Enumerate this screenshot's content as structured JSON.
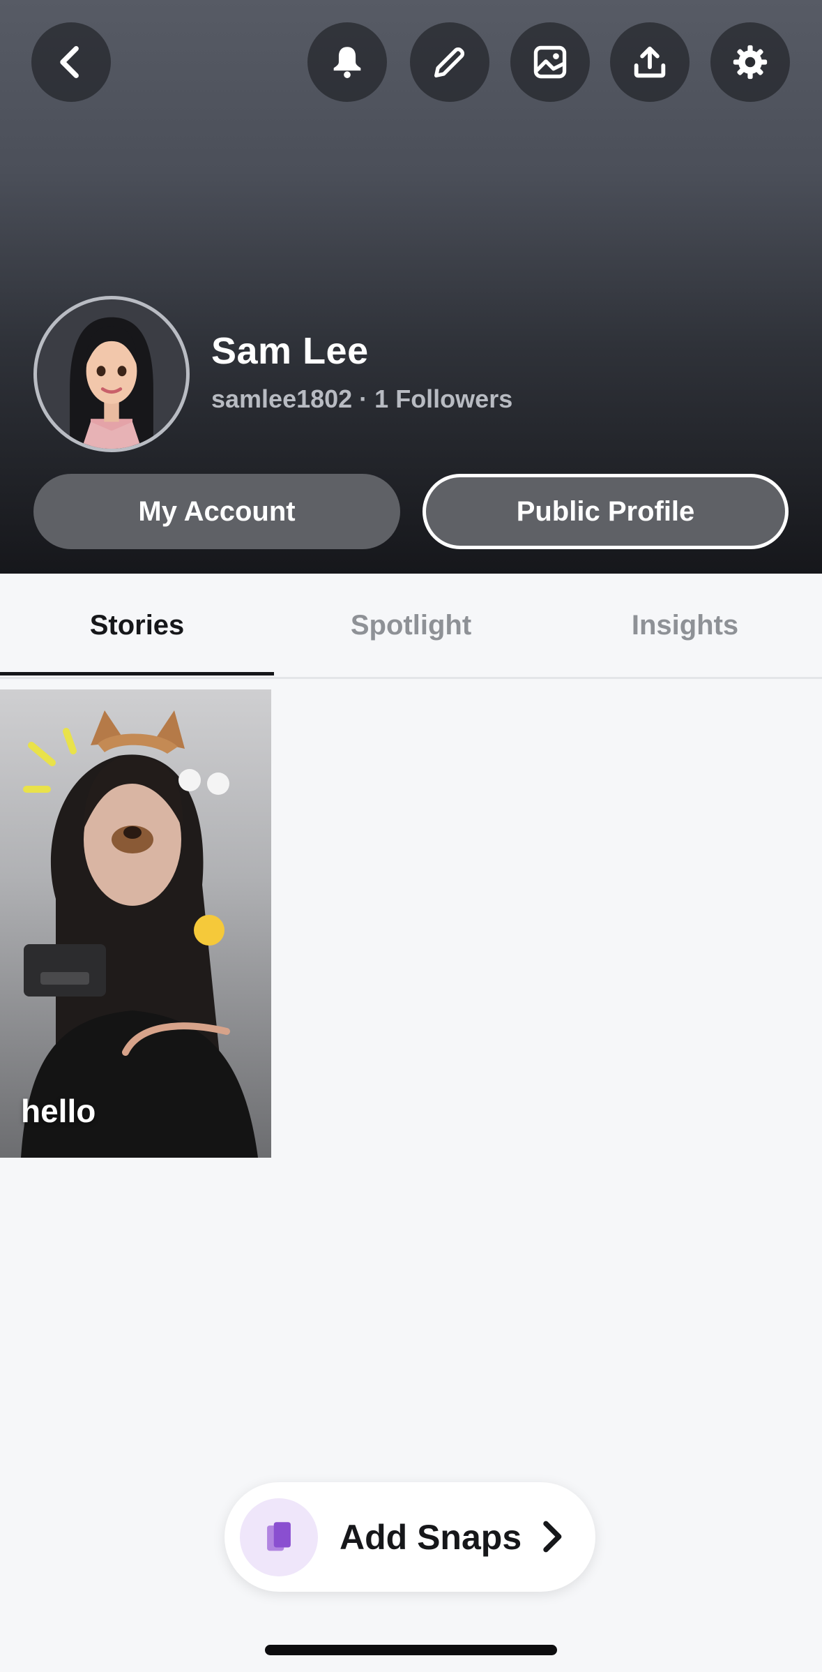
{
  "header": {
    "back_icon": "chevron-left-icon",
    "actions": [
      "bell-icon",
      "pencil-icon",
      "image-icon",
      "upload-icon",
      "gear-icon"
    ]
  },
  "profile": {
    "name": "Sam Lee",
    "username_line": "samlee1802 · 1 Followers",
    "my_account_label": "My Account",
    "public_profile_label": "Public Profile"
  },
  "tabs": {
    "stories": "Stories",
    "spotlight": "Spotlight",
    "insights": "Insights",
    "active": "Stories"
  },
  "stories": [
    {
      "label": "hello"
    }
  ],
  "add_snaps": {
    "label": "Add Snaps",
    "icon": "stacked-cards-icon",
    "chevron": "chevron-right-icon"
  },
  "colors": {
    "header_top": "#575b65",
    "header_bottom": "#16171b",
    "pill_bg": "#5f6166",
    "accent_purple": "#9b59d0",
    "background": "#f6f7f9"
  }
}
